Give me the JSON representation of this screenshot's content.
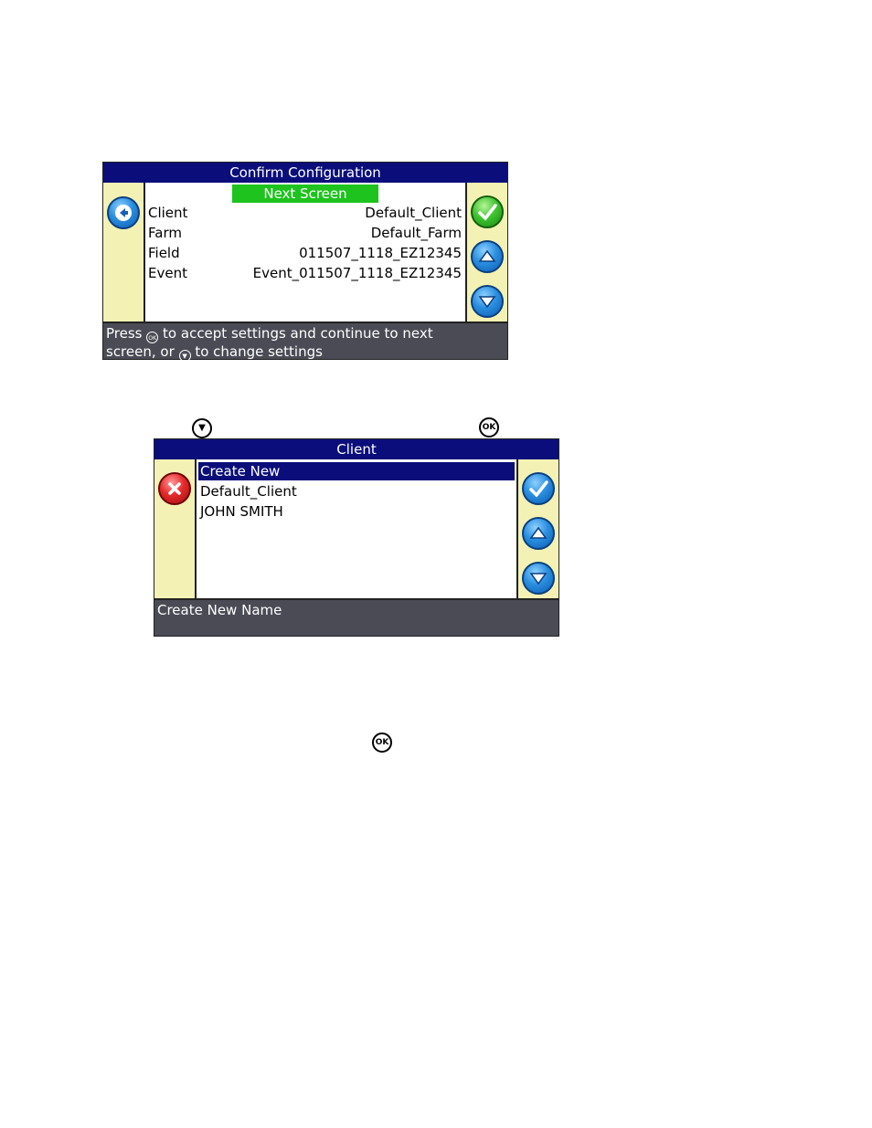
{
  "screen1": {
    "title": "Confirm Configuration",
    "next_screen": "Next Screen",
    "rows": [
      {
        "label": "Client",
        "value": "Default_Client"
      },
      {
        "label": "Farm",
        "value": "Default_Farm"
      },
      {
        "label": "Field",
        "value": "011507_1118_EZ12345"
      },
      {
        "label": "Event",
        "value": "Event_011507_1118_EZ12345"
      }
    ],
    "status_line1_pre": "Press",
    "status_line1_post": "to accept settings and continue to next",
    "status_line2_pre": "screen, or",
    "status_line2_post": "to change settings",
    "ok_glyph": "OK",
    "down_glyph": "▼",
    "icons": [
      "back-arrow-icon",
      "check-icon",
      "up-arrow-icon",
      "down-arrow-icon"
    ],
    "colors": {
      "titlebar": "#0b0e7a",
      "next_screen": "#1ec31e",
      "sidebar": "#f3f2b4",
      "status": "#4a4b55"
    }
  },
  "keys_between": {
    "down_glyph": "▼",
    "ok_glyph": "OK"
  },
  "screen2": {
    "title": "Client",
    "items": [
      "Create New",
      "Default_Client",
      "JOHN SMITH"
    ],
    "selected_index": 0,
    "status": "Create New Name",
    "icons": [
      "close-x-icon",
      "check-icon",
      "up-arrow-icon",
      "down-arrow-icon"
    ]
  },
  "key_bottom": {
    "ok_glyph": "OK"
  }
}
